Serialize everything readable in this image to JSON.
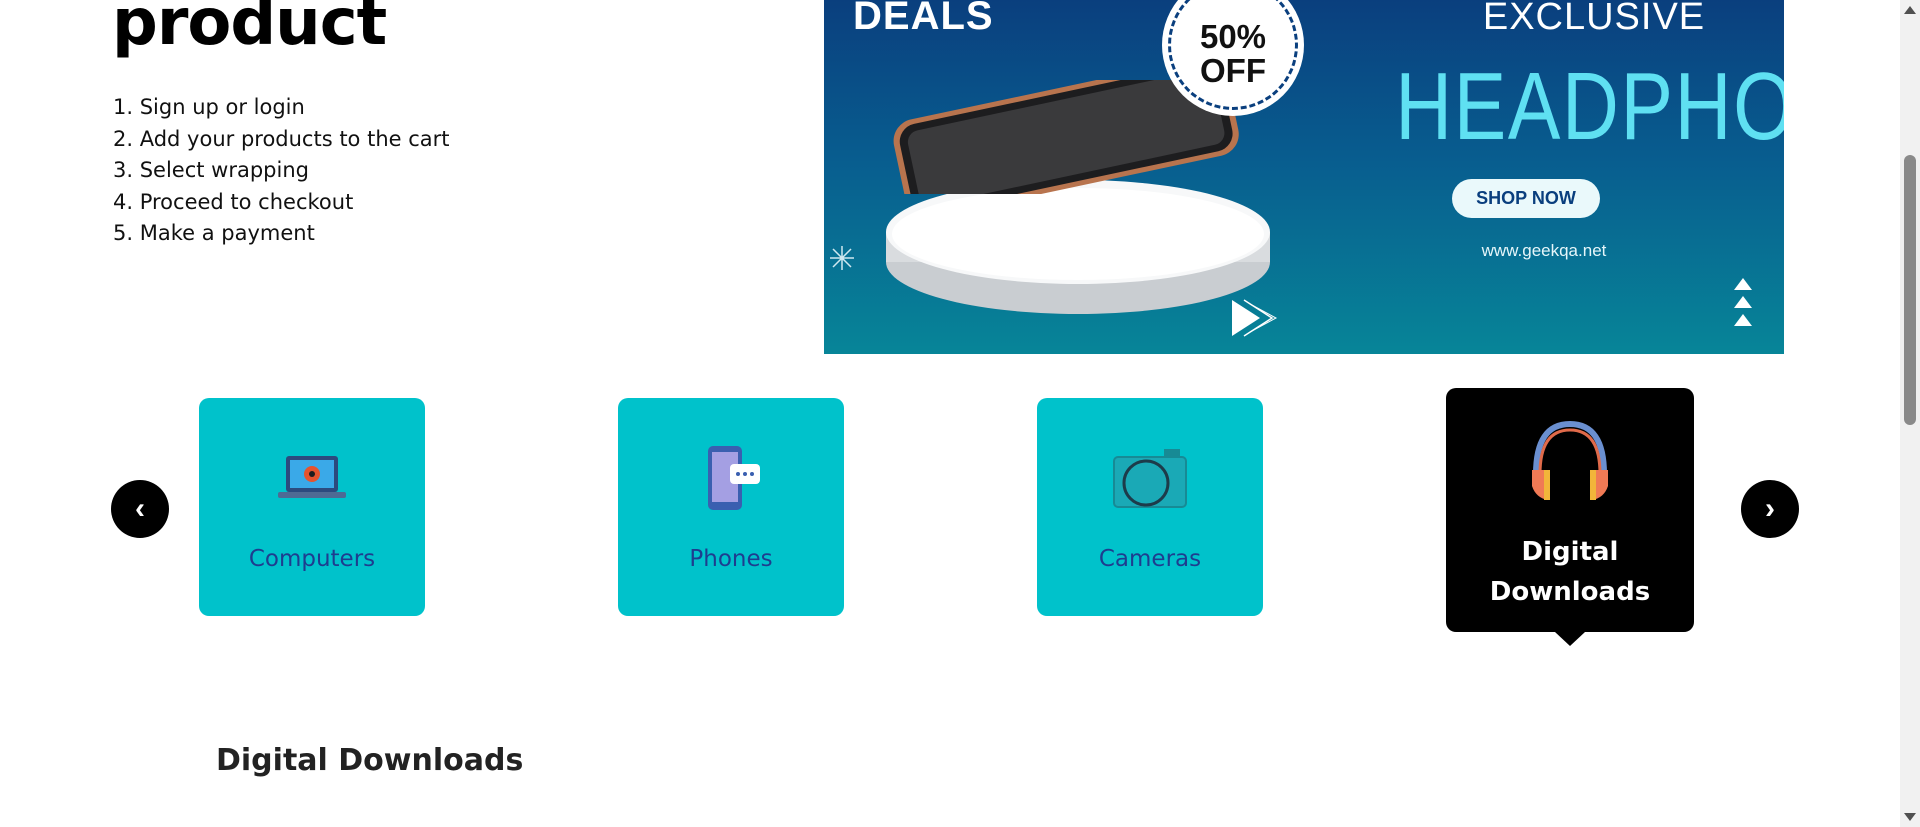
{
  "hero": {
    "title": "product",
    "steps": [
      "1. Sign up or login",
      "2. Add your products to the cart",
      "3. Select wrapping",
      "4. Proceed to checkout",
      "5. Make a payment"
    ]
  },
  "banner": {
    "deals": "DEALS",
    "badge_percent": "50%",
    "badge_off": "OFF",
    "exclusive": "EXCLUSIVE",
    "headline": "HEADPHONE",
    "cta": "SHOP NOW",
    "site": "www.geekqa.net"
  },
  "carousel": {
    "prev_icon": "‹",
    "next_icon": "›",
    "categories": [
      {
        "label": "Computers",
        "icon": "laptop-icon",
        "active": false
      },
      {
        "label": "Phones",
        "icon": "phone-chat-icon",
        "active": false
      },
      {
        "label": "Cameras",
        "icon": "camera-icon",
        "active": false
      },
      {
        "label": "Digital Downloads",
        "icon": "headphones-icon",
        "active": true
      }
    ]
  },
  "section": {
    "title": "Digital Downloads"
  },
  "colors": {
    "card_bg": "#00c2cb",
    "card_text": "#1e3d8f",
    "active_bg": "#000000",
    "banner_top": "#0a3f7e",
    "banner_bottom": "#078598",
    "headline": "#5fe0f2"
  }
}
